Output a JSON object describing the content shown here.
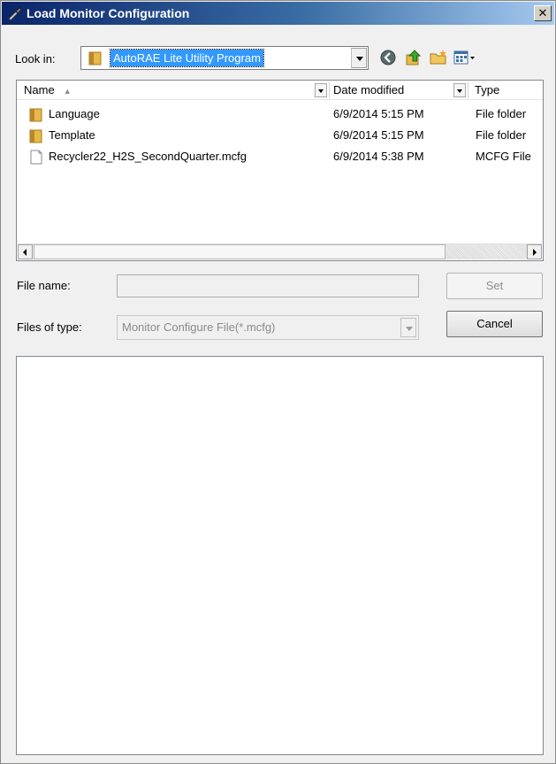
{
  "window": {
    "title": "Load Monitor Configuration",
    "close_glyph": "✕"
  },
  "lookin": {
    "label": "Look in:",
    "value": "AutoRAE Lite Utility Program",
    "icon": "folder-icon"
  },
  "toolbar": {
    "back_icon": "back-icon",
    "up_icon": "up-folder-icon",
    "new_folder_icon": "new-folder-icon",
    "view_icon": "view-menu-icon"
  },
  "columns": {
    "name": "Name",
    "date": "Date modified",
    "type": "Type"
  },
  "files": [
    {
      "name": "Language",
      "date": "6/9/2014 5:15 PM",
      "type": "File folder",
      "icon": "folder-icon"
    },
    {
      "name": "Template",
      "date": "6/9/2014 5:15 PM",
      "type": "File folder",
      "icon": "folder-icon"
    },
    {
      "name": "Recycler22_H2S_SecondQuarter.mcfg",
      "date": "6/9/2014 5:38 PM",
      "type": "MCFG File",
      "icon": "file-icon"
    }
  ],
  "filename": {
    "label": "File name:",
    "value": ""
  },
  "filetype": {
    "label": "Files of type:",
    "value": "Monitor Configure File(*.mcfg)"
  },
  "buttons": {
    "set": "Set",
    "cancel": "Cancel"
  },
  "colors": {
    "titlebar": "#0a246a",
    "selection": "#3399ff",
    "folder": "#e8b84a"
  }
}
